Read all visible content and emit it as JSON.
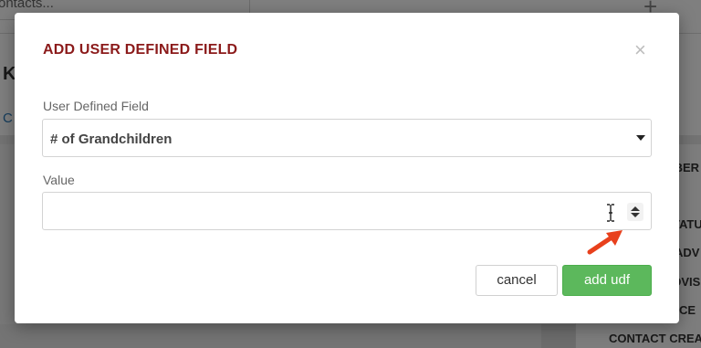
{
  "background": {
    "search_placeholder": "ontacts...",
    "plus_symbol": "+",
    "header_letter": "K",
    "link_letter": "C",
    "right_column_items": [
      "IBER",
      "TATU",
      "ADV",
      "DVIS",
      "CE"
    ],
    "bottom_label": "CONTACT CREA"
  },
  "modal": {
    "title": "ADD USER DEFINED FIELD",
    "close_symbol": "×",
    "udf_label": "User Defined Field",
    "udf_selected": "# of Grandchildren",
    "value_label": "Value",
    "value_input": "",
    "cancel_label": "cancel",
    "add_label": "add udf"
  },
  "colors": {
    "title": "#8b1a1a",
    "primary_button": "#5cb85c",
    "annotation_arrow": "#e8401c"
  }
}
